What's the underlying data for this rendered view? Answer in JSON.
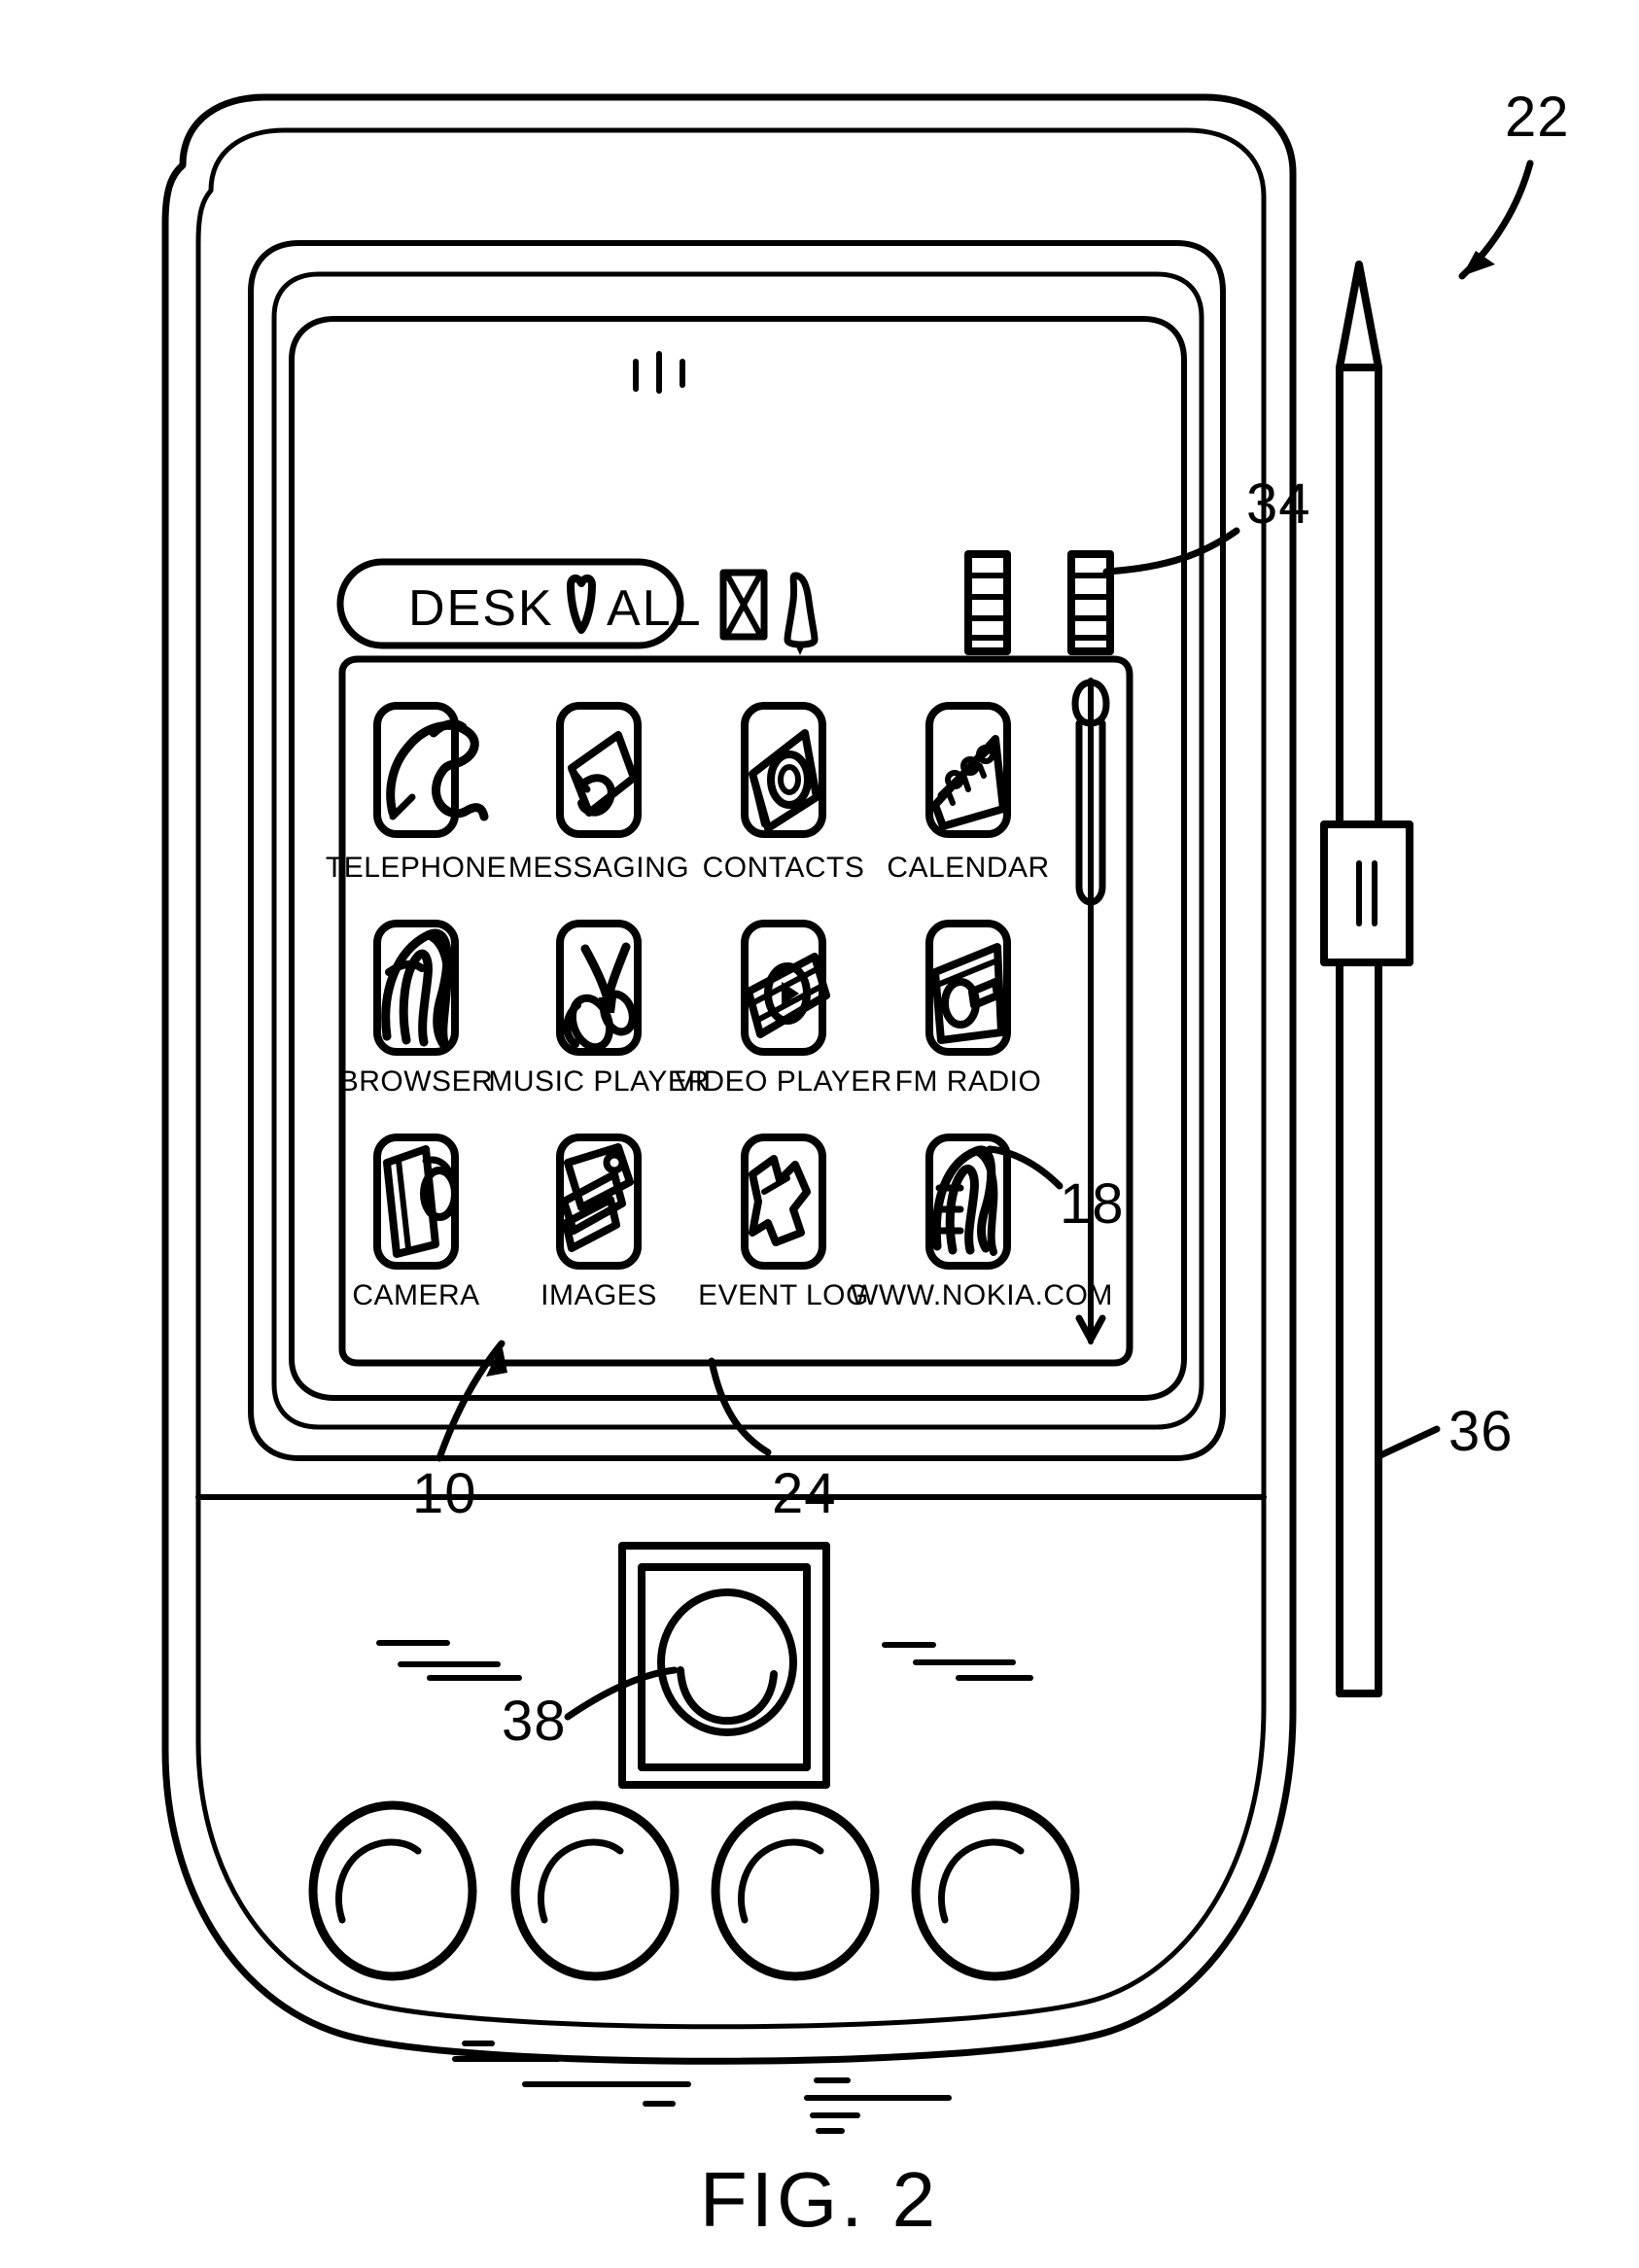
{
  "figure": {
    "caption": "FIG. 2",
    "kind": "patent-line-drawing",
    "subject": "handheld communication device with touchscreen, stylus, navigation key and function keys"
  },
  "statusbar": {
    "title_pill_text": "DESK ☉ ALL",
    "title_left_word": "DESK",
    "title_right_word": "ALL",
    "title_separator_icon": "tulip-glyph-icon",
    "indicators": [
      {
        "name": "hourglass-icon",
        "glyph": "hourglass"
      },
      {
        "name": "bell-icon",
        "glyph": "bell"
      },
      {
        "name": "signal-bars-icon",
        "glyph": "bars"
      },
      {
        "name": "battery-bars-icon",
        "glyph": "bars"
      }
    ]
  },
  "scrollbar": {
    "thumb_name": "scrollbar-thumb",
    "down_arrow_name": "scrollbar-down-arrow"
  },
  "app_grid": {
    "rows": 3,
    "columns": 4,
    "apps": [
      {
        "label": "TELEPHONE",
        "icon": "telephone-handset-icon"
      },
      {
        "label": "MESSAGING",
        "icon": "messaging-envelope-icon"
      },
      {
        "label": "CONTACTS",
        "icon": "contacts-card-icon"
      },
      {
        "label": "CALENDAR",
        "icon": "calendar-icon"
      },
      {
        "label": "BROWSER",
        "icon": "browser-globe-icon"
      },
      {
        "label": "MUSIC  PLAYER",
        "icon": "music-note-icon"
      },
      {
        "label": "VIDEO  PLAYER",
        "icon": "video-filmstrip-icon"
      },
      {
        "label": "FM  RADIO",
        "icon": "fm-radio-icon"
      },
      {
        "label": "CAMERA",
        "icon": "camera-icon"
      },
      {
        "label": "IMAGES",
        "icon": "images-photo-icon"
      },
      {
        "label": "EVENT  LOG",
        "icon": "event-log-icon"
      },
      {
        "label": "WWW.NOKIA.COM",
        "icon": "nokia-web-icon"
      }
    ]
  },
  "reference_numerals": [
    {
      "id": "22",
      "label": "22",
      "points_to": "device-body",
      "leader": "curved-arrow"
    },
    {
      "id": "34",
      "label": "34",
      "points_to": "scrollbar",
      "leader": "curved"
    },
    {
      "id": "18",
      "label": "18",
      "points_to": "app-icon",
      "leader": "curved"
    },
    {
      "id": "36",
      "label": "36",
      "points_to": "stylus",
      "leader": "straight"
    },
    {
      "id": "10",
      "label": "10",
      "points_to": "display-screen",
      "leader": "straight-arrow"
    },
    {
      "id": "24",
      "label": "24",
      "points_to": "display-bezel",
      "leader": "curved"
    },
    {
      "id": "38",
      "label": "38",
      "points_to": "navigation-key",
      "leader": "curved"
    }
  ],
  "hardware": {
    "stylus_name": "stylus",
    "navigation_key_name": "navigation-key",
    "function_keys": [
      {
        "name": "function-key-1"
      },
      {
        "name": "function-key-2"
      },
      {
        "name": "function-key-3"
      },
      {
        "name": "function-key-4"
      }
    ],
    "speaker_grille_name": "speaker-grille"
  },
  "colors": {
    "ink": "#000000",
    "paper": "#ffffff"
  }
}
